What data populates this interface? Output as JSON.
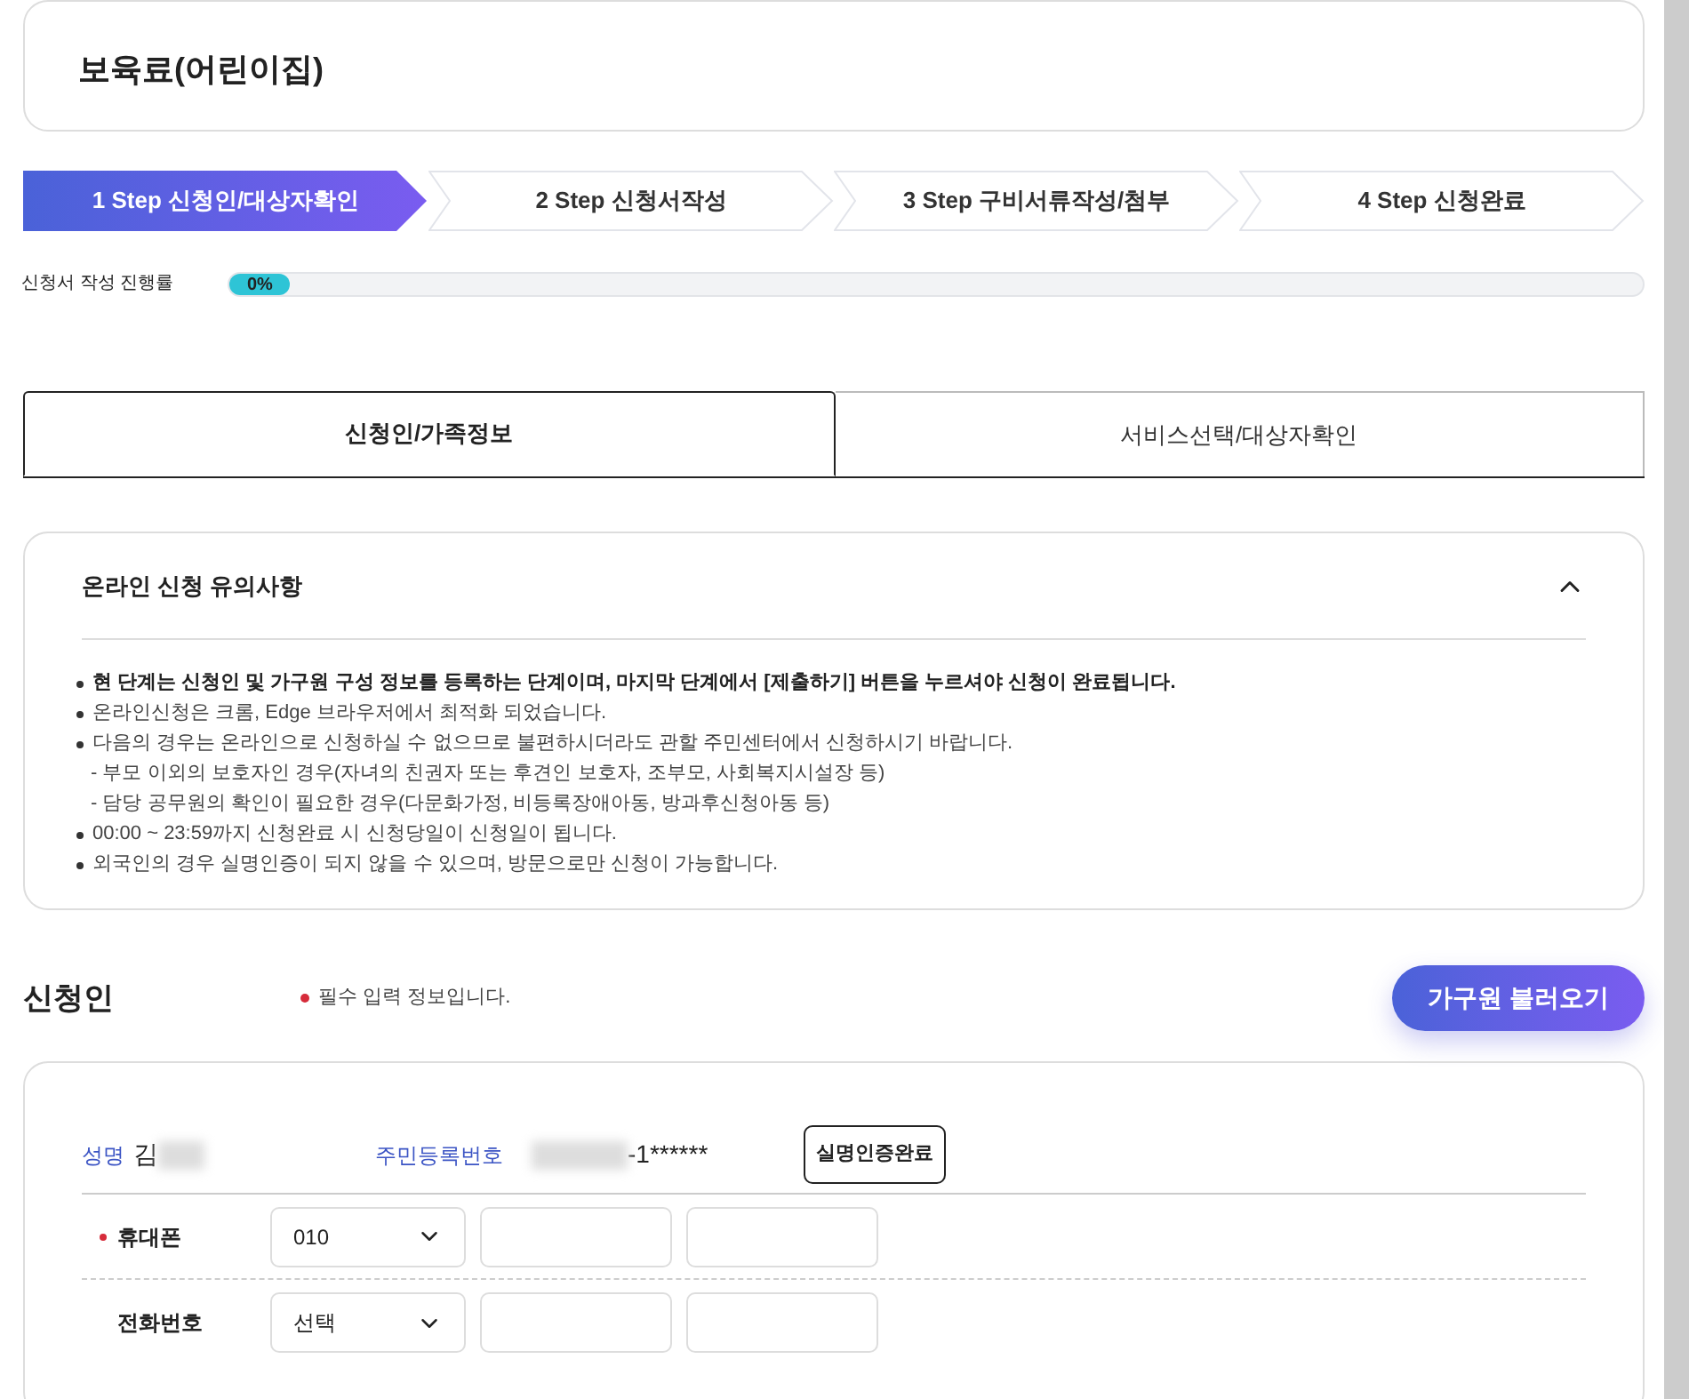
{
  "page_title": "보육료(어린이집)",
  "steps": [
    {
      "label": "1 Step 신청인/대상자확인",
      "selected": true
    },
    {
      "label": "2 Step 신청서작성",
      "selected": false
    },
    {
      "label": "3 Step 구비서류작성/첨부",
      "selected": false
    },
    {
      "label": "4 Step 신청완료",
      "selected": false
    }
  ],
  "progress": {
    "label": "신청서 작성 진행률",
    "reading": "0%",
    "level": 0
  },
  "tabs": [
    {
      "label": "신청인/가족정보",
      "selected": true
    },
    {
      "label": "서비스선택/대상자확인",
      "selected": false
    }
  ],
  "notice": {
    "title": "온라인 신청 유의사항",
    "expanded": true,
    "items": [
      {
        "kind": "bullet",
        "bold": true,
        "text": "현 단계는 신청인 및 가구원 구성 정보를 등록하는 단계이며, 마지막 단계에서 [제출하기] 버튼을 누르셔야 신청이 완료됩니다."
      },
      {
        "kind": "bullet",
        "bold": false,
        "text": "온라인신청은 크롬, Edge 브라우저에서 최적화 되었습니다."
      },
      {
        "kind": "bullet",
        "bold": false,
        "text": "다음의 경우는 온라인으로 신청하실 수 없으므로 불편하시더라도 관할 주민센터에서 신청하시기 바랍니다."
      },
      {
        "kind": "sub",
        "bold": false,
        "text": "- 부모 이외의 보호자인 경우(자녀의 친권자 또는 후견인 보호자, 조부모, 사회복지시설장 등)"
      },
      {
        "kind": "sub",
        "bold": false,
        "text": "- 담당 공무원의 확인이 필요한 경우(다문화가정, 비등록장애아동, 방과후신청아동 등)"
      },
      {
        "kind": "bullet",
        "bold": false,
        "text": "00:00 ~ 23:59까지 신청완료 시 신청당일이 신청일이 됩니다."
      },
      {
        "kind": "bullet",
        "bold": false,
        "text": "외국인의 경우 실명인증이 되지 않을 수 있으며, 방문으로만 신청이 가능합니다."
      }
    ]
  },
  "applicant": {
    "heading": "신청인",
    "required_note": "필수 입력 정보입니다.",
    "load_button": "가구원 불러오기",
    "name_label": "성명",
    "name_value": "김",
    "rrn_label": "주민등록번호",
    "rrn_value": "-1******",
    "verified_badge": "실명인증완료",
    "rows": [
      {
        "label": "휴대폰",
        "required": true,
        "select": "010"
      },
      {
        "label": "전화번호",
        "required": false,
        "select": "선택"
      }
    ]
  }
}
